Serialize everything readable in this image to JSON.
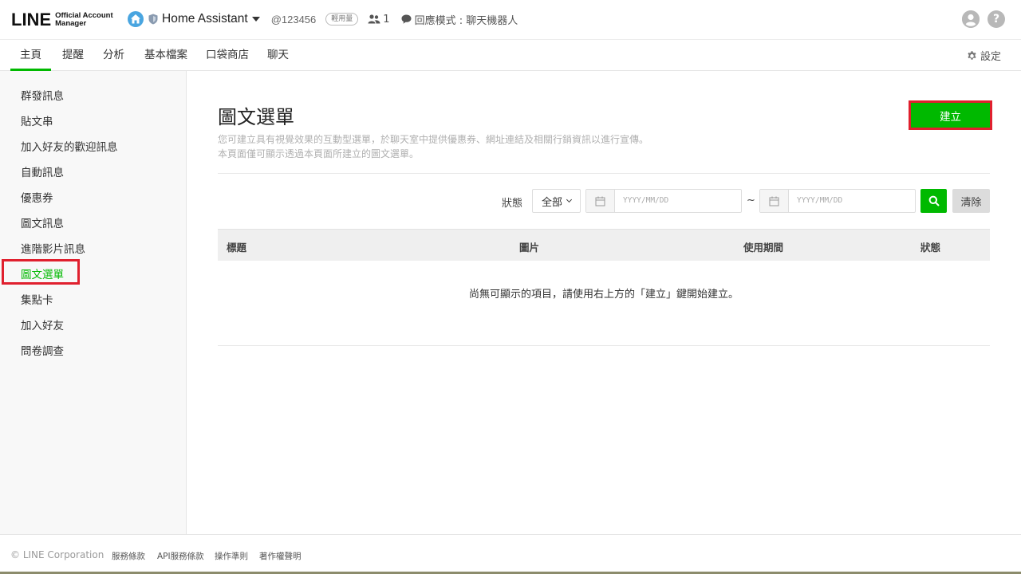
{
  "header": {
    "logo_main": "LINE",
    "logo_sub_1": "Official Account",
    "logo_sub_2": "Manager",
    "account_name": "Home Assistant",
    "account_id": "@123456",
    "plan_badge": "輕用量",
    "friend_count": "1",
    "reply_mode": "回應模式 : 聊天機器人"
  },
  "nav": {
    "tabs": [
      "主頁",
      "提醒",
      "分析",
      "基本檔案",
      "口袋商店",
      "聊天"
    ],
    "active_tab": "主頁",
    "settings_label": "設定"
  },
  "sidebar": {
    "items": [
      "群發訊息",
      "貼文串",
      "加入好友的歡迎訊息",
      "自動訊息",
      "優惠券",
      "圖文訊息",
      "進階影片訊息",
      "圖文選單",
      "集點卡",
      "加入好友",
      "問卷調查"
    ],
    "active_item": "圖文選單"
  },
  "main": {
    "title": "圖文選單",
    "desc_line1": "您可建立具有視覺效果的互動型選單，於聊天室中提供優惠券、網址連結及相關行銷資訊以進行宣傳。",
    "desc_line2": "本頁面僅可顯示透過本頁面所建立的圖文選單。",
    "create_button": "建立"
  },
  "filter": {
    "status_label": "狀態",
    "status_value": "全部",
    "date_from_placeholder": "YYYY/MM/DD",
    "date_to_placeholder": "YYYY/MM/DD",
    "tilde": "~",
    "clear_button": "清除"
  },
  "table": {
    "headers": [
      "標題",
      "圖片",
      "使用期間",
      "狀態"
    ],
    "empty_message": "尚無可顯示的項目，請使用右上方的「建立」鍵開始建立。"
  },
  "footer": {
    "copyright": "© LINE Corporation",
    "links": [
      "服務條款",
      "API服務條款",
      "操作準則",
      "著作權聲明"
    ]
  },
  "colors": {
    "brand_green": "#00b900",
    "highlight_red": "#e0202e"
  }
}
